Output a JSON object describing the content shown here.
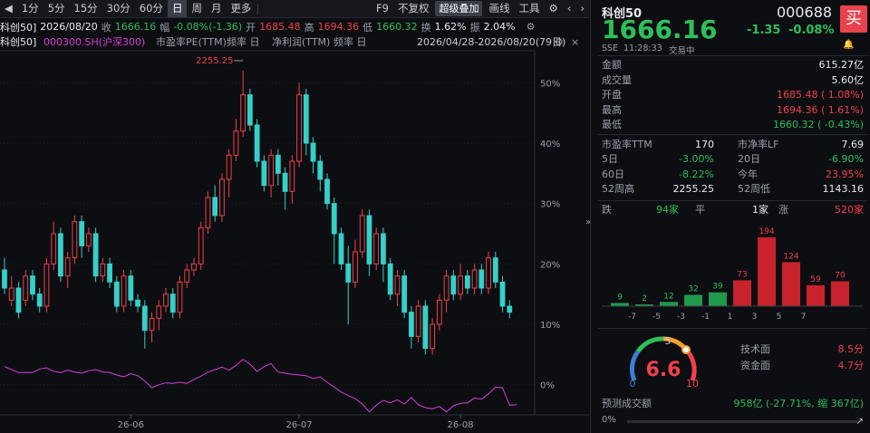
{
  "toolbar": {
    "periods": [
      "1分",
      "5分",
      "15分",
      "30分",
      "60分",
      "日",
      "周",
      "月",
      "更多"
    ],
    "active_period": "日",
    "f9": "F9",
    "fq": "不复权",
    "overlay": "超级叠加",
    "draw": "画线",
    "tools": "工具"
  },
  "infobar": {
    "name": "科创50]",
    "date": "2026/08/20",
    "close_label": "收",
    "close": "1666.16",
    "chg_label": "幅",
    "chg": "-0.08%(-1.36)",
    "open_label": "开",
    "open": "1685.48",
    "high_label": "高",
    "high": "1694.36",
    "low_label": "低",
    "low": "1660.32",
    "turn_label": "换",
    "turn": "1.62%",
    "amp_label": "振",
    "amp": "2.04%"
  },
  "legend": {
    "main": "科创50]",
    "compare": "000300.SH(沪深300)",
    "ind1": "市盈率PE(TTM)",
    "ind1_freq": "频率 日",
    "ind2": "净利润(TTM)",
    "ind2_freq": "频率 日",
    "range": "2026/04/28-2026/08/20(79日)"
  },
  "chart_data": {
    "type": "candlestick",
    "y_unit": "percent change",
    "y_ticks": [
      "50%",
      "40%",
      "30%",
      "20%",
      "10%",
      "0%"
    ],
    "x_ticks": [
      "26-06",
      "26-07",
      "26-08"
    ],
    "max_label": "2255.25",
    "candles": [
      [
        19,
        16,
        21,
        15
      ],
      [
        14,
        16,
        18,
        13
      ],
      [
        16,
        12,
        17,
        11
      ],
      [
        14,
        18,
        19,
        13
      ],
      [
        18,
        15,
        19,
        14
      ],
      [
        15,
        13,
        16,
        12
      ],
      [
        13,
        20,
        21,
        12
      ],
      [
        20,
        25,
        27,
        19
      ],
      [
        25,
        18,
        26,
        17
      ],
      [
        18,
        21,
        22,
        16
      ],
      [
        21,
        27,
        28,
        20
      ],
      [
        27,
        23,
        28,
        21
      ],
      [
        23,
        25,
        26,
        22
      ],
      [
        25,
        18,
        26,
        17
      ],
      [
        18,
        20,
        21,
        17
      ],
      [
        20,
        17,
        21,
        16
      ],
      [
        17,
        13,
        18,
        12
      ],
      [
        13,
        18,
        19,
        12
      ],
      [
        18,
        14,
        19,
        13
      ],
      [
        14,
        13,
        15,
        12
      ],
      [
        13,
        9,
        14,
        6
      ],
      [
        9,
        11,
        12,
        7
      ],
      [
        11,
        13,
        14,
        9
      ],
      [
        13,
        15,
        16,
        12
      ],
      [
        15,
        12,
        16,
        11
      ],
      [
        12,
        17,
        18,
        11
      ],
      [
        17,
        19,
        20,
        16
      ],
      [
        19,
        20,
        21,
        18
      ],
      [
        20,
        26,
        27,
        19
      ],
      [
        26,
        31,
        32,
        25
      ],
      [
        31,
        28,
        33,
        27
      ],
      [
        28,
        34,
        35,
        27
      ],
      [
        34,
        38,
        39,
        31
      ],
      [
        38,
        42,
        44,
        37
      ],
      [
        42,
        48,
        52,
        41
      ],
      [
        48,
        43,
        49,
        42
      ],
      [
        43,
        37,
        44,
        36
      ],
      [
        37,
        33,
        38,
        32
      ],
      [
        33,
        38,
        39,
        31
      ],
      [
        38,
        35,
        39,
        33
      ],
      [
        35,
        32,
        36,
        29
      ],
      [
        32,
        37,
        38,
        30
      ],
      [
        37,
        48,
        50,
        36
      ],
      [
        48,
        40,
        49,
        38
      ],
      [
        40,
        37,
        41,
        35
      ],
      [
        37,
        34,
        38,
        32
      ],
      [
        34,
        30,
        35,
        29
      ],
      [
        30,
        25,
        31,
        20
      ],
      [
        25,
        20,
        26,
        19
      ],
      [
        20,
        17,
        23,
        10
      ],
      [
        17,
        22,
        24,
        16
      ],
      [
        22,
        28,
        29,
        21
      ],
      [
        28,
        20,
        29,
        18
      ],
      [
        20,
        25,
        26,
        19
      ],
      [
        25,
        20,
        26,
        17
      ],
      [
        20,
        15,
        21,
        14
      ],
      [
        15,
        18,
        19,
        13
      ],
      [
        18,
        12,
        19,
        11
      ],
      [
        12,
        8,
        13,
        6
      ],
      [
        8,
        13,
        14,
        7
      ],
      [
        13,
        6,
        14,
        5
      ],
      [
        6,
        10,
        11,
        5
      ],
      [
        10,
        14,
        15,
        9
      ],
      [
        14,
        18,
        19,
        12
      ],
      [
        18,
        15,
        19,
        14
      ],
      [
        15,
        18,
        20,
        14
      ],
      [
        18,
        16,
        19,
        15
      ],
      [
        16,
        19,
        20,
        15
      ],
      [
        19,
        16,
        20,
        15
      ],
      [
        16,
        21,
        22,
        15
      ],
      [
        21,
        17,
        22,
        16
      ],
      [
        17,
        13,
        18,
        12
      ],
      [
        13,
        12,
        14,
        11
      ]
    ],
    "pe_line": [
      3,
      2.5,
      2,
      2,
      2,
      2.6,
      2.8,
      2.2,
      2,
      2.4,
      2.1,
      1.9,
      2.3,
      2.5,
      2.1,
      2,
      1.6,
      1.3,
      1.8,
      1.5,
      0.6,
      -0.5,
      0,
      0.3,
      0.2,
      0.4,
      0.2,
      0.9,
      1.4,
      2.1,
      2.5,
      2.9,
      2.4,
      3.2,
      4.2,
      3.4,
      2.2,
      3,
      3.5,
      2.1,
      1.9,
      1.7,
      1.6,
      1.5,
      1,
      1.3,
      0.4,
      -0.4,
      -1.2,
      -1.8,
      -2.3,
      -3.2,
      -4.5,
      -3.4,
      -2.6,
      -3,
      -2.5,
      -3.2,
      -2.1,
      -3.3,
      -3.8,
      -4,
      -3.6,
      -4.5,
      -3.5,
      -3.1,
      -3,
      -2.2,
      -2.4,
      -1.5,
      -0.4,
      -0.5,
      -3.4,
      -3.3
    ]
  },
  "quote": {
    "name": "科创50",
    "code": "000688",
    "price": "1666.16",
    "change": "-1.35",
    "change_pct": "-0.08%",
    "exchange": "SSE",
    "time": "11:28:33",
    "status": "交易中",
    "buy": "买"
  },
  "stats": [
    {
      "label": "金额",
      "value": "615.27亿",
      "color": "white"
    },
    {
      "label": "成交量",
      "value": "5.60亿",
      "color": "white"
    },
    {
      "label": "开盘",
      "value": "1685.48 ( 1.08%)",
      "color": "red"
    },
    {
      "label": "最高",
      "value": "1694.36 ( 1.61%)",
      "color": "red"
    },
    {
      "label": "最低",
      "value": "1660.32 ( -0.43%)",
      "color": "green"
    }
  ],
  "pe": {
    "pe_label": "市盈率TTM",
    "pe_value": "170",
    "pb_label": "市净率LF",
    "pb_value": "7.69"
  },
  "perf": [
    {
      "l1": "5日",
      "v1": "-3.00%",
      "c1": "green",
      "l2": "20日",
      "v2": "-6.90%",
      "c2": "green"
    },
    {
      "l1": "60日",
      "v1": "-8.22%",
      "c1": "green",
      "l2": "今年",
      "v2": "23.95%",
      "c2": "red"
    },
    {
      "l1": "52周高",
      "v1": "2255.25",
      "c1": "white",
      "l2": "52周低",
      "v2": "1143.16",
      "c2": "white"
    }
  ],
  "breadth": {
    "down_label": "跌",
    "down": "94家",
    "flat_label": "平",
    "flat": "1家",
    "up_label": "涨",
    "up": "520家",
    "bins": [
      -7,
      -5,
      -3,
      -1,
      1,
      3,
      5,
      7
    ],
    "bars": [
      {
        "v": 9,
        "c": "green"
      },
      {
        "v": 2,
        "c": "green"
      },
      {
        "v": 12,
        "c": "green"
      },
      {
        "v": 32,
        "c": "green"
      },
      {
        "v": 39,
        "c": "green"
      },
      {
        "v": 73,
        "c": "red"
      },
      {
        "v": 194,
        "c": "red"
      },
      {
        "v": 124,
        "c": "red"
      },
      {
        "v": 59,
        "c": "red"
      },
      {
        "v": 70,
        "c": "red"
      }
    ]
  },
  "gauge": {
    "value": "6.6",
    "min": "0",
    "mid": "5",
    "max": "10",
    "tech_label": "技术面",
    "tech": "8.5分",
    "fund_label": "资金面",
    "fund": "4.7分"
  },
  "forecast": {
    "label": "预测成交额",
    "value": "958亿 (-27.71%, 缩 367亿)",
    "progress": "0%"
  }
}
